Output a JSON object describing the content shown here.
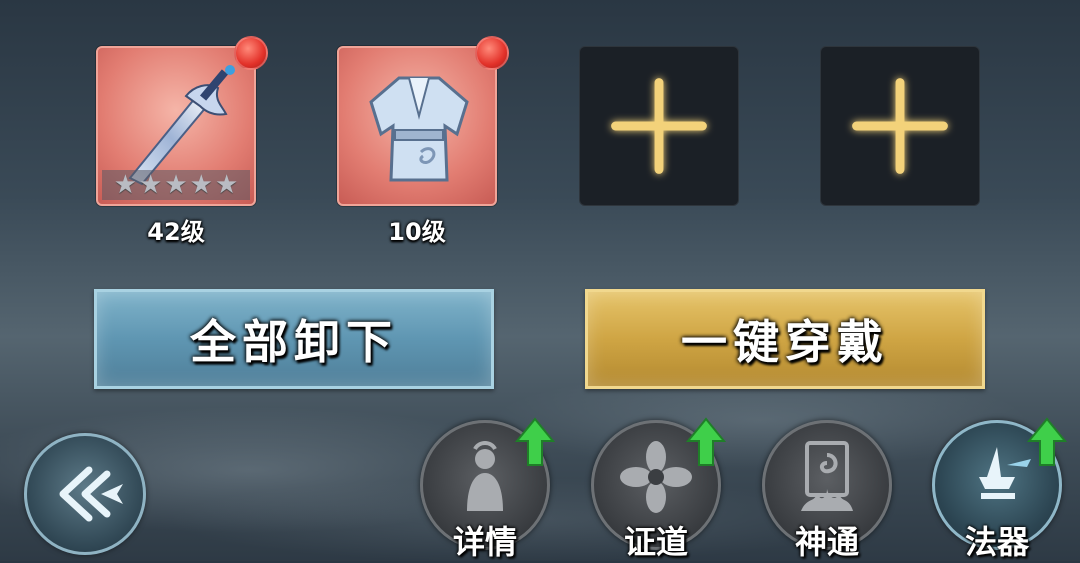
{
  "equipment": {
    "slots": [
      {
        "type": "weapon",
        "level_label": "42级",
        "stars": 5,
        "has_red_dot": true
      },
      {
        "type": "armor",
        "level_label": "10级",
        "has_red_dot": true
      },
      {
        "type": "empty"
      },
      {
        "type": "empty"
      }
    ]
  },
  "buttons": {
    "unequip_all": "全部卸下",
    "one_click_equip": "一键穿戴"
  },
  "menu": [
    {
      "label": "详情",
      "has_upgrade_arrow": true
    },
    {
      "label": "证道",
      "has_upgrade_arrow": true
    },
    {
      "label": "神通",
      "has_upgrade_arrow": false
    },
    {
      "label": "法器",
      "has_upgrade_arrow": true
    }
  ],
  "colors": {
    "unequip_button": "#5f96b2",
    "equip_button": "#cfa544",
    "item_card_bg": "#e27d72",
    "red_dot": "#e3322a",
    "plus_glow": "#f3d27a",
    "upgrade_arrow": "#3fcf4a"
  }
}
